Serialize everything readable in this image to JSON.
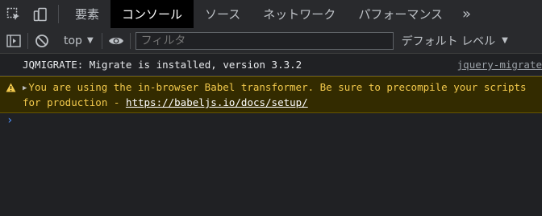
{
  "tabs": [
    {
      "label": "要素",
      "active": false
    },
    {
      "label": "コンソール",
      "active": true
    },
    {
      "label": "ソース",
      "active": false
    },
    {
      "label": "ネットワーク",
      "active": false
    },
    {
      "label": "パフォーマンス",
      "active": false
    }
  ],
  "more_tabs_glyph": "»",
  "toolbar": {
    "context": "top",
    "filter_placeholder": "フィルタ",
    "levels": "デフォルト レベル"
  },
  "messages": {
    "info": {
      "text": "JQMIGRATE: Migrate is installed, version 3.3.2",
      "source": "jquery-migrate"
    },
    "warning": {
      "text": "You are using the in-browser Babel transformer. Be sure to precompile your scripts for production - ",
      "link": "https://babeljs.io/docs/setup/"
    }
  },
  "prompt_glyph": "›",
  "colors": {
    "background": "#202124",
    "toolbar": "#292a2d",
    "warning_bg": "#332b00",
    "warning_text": "#f2c94c",
    "prompt": "#4d90fe"
  }
}
